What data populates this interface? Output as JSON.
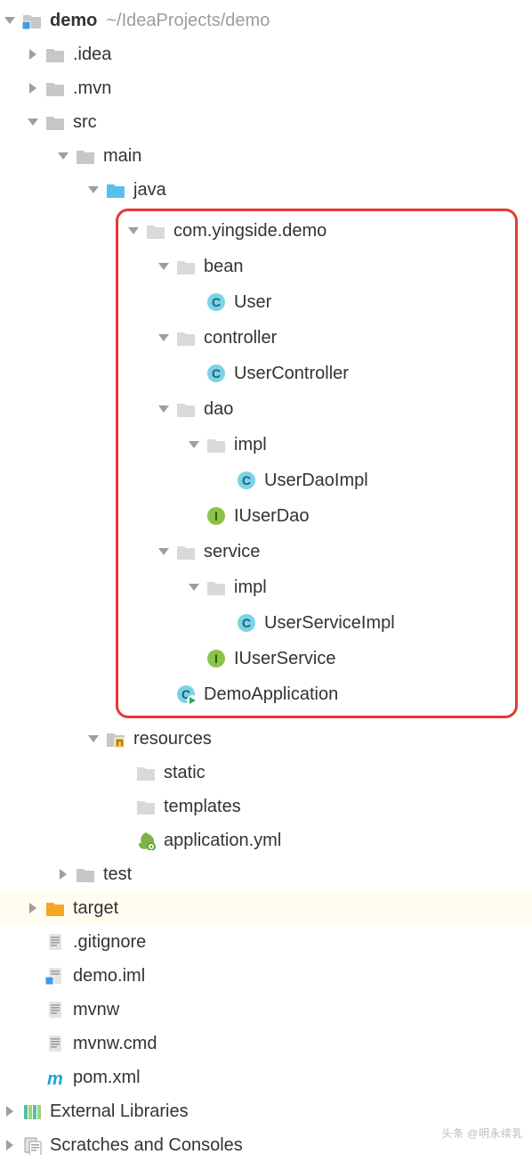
{
  "root": {
    "name": "demo",
    "path": "~/IdeaProjects/demo"
  },
  "tree": {
    "idea": ".idea",
    "mvn": ".mvn",
    "src": "src",
    "main": "main",
    "java": "java",
    "pkg": "com.yingside.demo",
    "bean": "bean",
    "user": "User",
    "controller": "controller",
    "userController": "UserController",
    "dao": "dao",
    "daoImpl": "impl",
    "userDaoImpl": "UserDaoImpl",
    "iUserDao": "IUserDao",
    "service": "service",
    "serviceImpl": "impl",
    "userServiceImpl": "UserServiceImpl",
    "iUserService": "IUserService",
    "demoApplication": "DemoApplication",
    "resources": "resources",
    "static": "static",
    "templates": "templates",
    "appYml": "application.yml",
    "test": "test",
    "target": "target",
    "gitignore": ".gitignore",
    "demoIml": "demo.iml",
    "mvnw": "mvnw",
    "mvnwCmd": "mvnw.cmd",
    "pom": "pom.xml",
    "extLib": "External Libraries",
    "scratches": "Scratches and Consoles"
  },
  "watermark": "头条 @明永续乳"
}
